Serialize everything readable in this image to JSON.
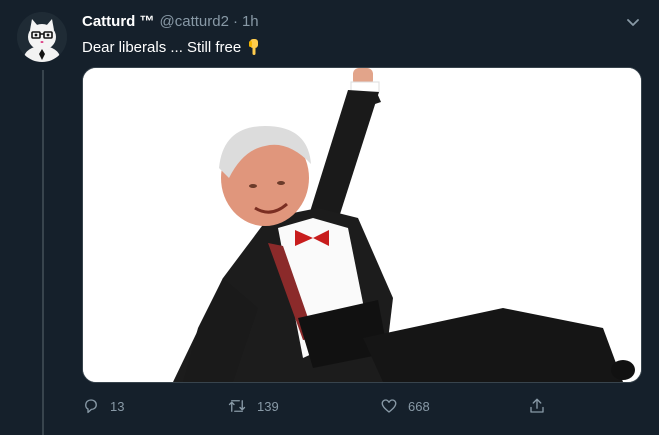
{
  "tweet": {
    "display_name": "Catturd ™",
    "handle": "@catturd2",
    "separator": "·",
    "time": "1h",
    "text": "Dear liberals ... Still free",
    "text_emoji": "backhand-index-pointing-down-icon",
    "media": {
      "description_icon": "meme-image"
    }
  },
  "actions": {
    "reply_count": "13",
    "retweet_count": "139",
    "like_count": "668",
    "reply_icon": "reply-icon",
    "retweet_icon": "retweet-icon",
    "like_icon": "heart-icon",
    "share_icon": "share-icon"
  },
  "colors": {
    "background": "#15202b",
    "secondary_text": "#8899a6",
    "border": "#38444d",
    "emoji_yellow": "#ffcc4d"
  }
}
